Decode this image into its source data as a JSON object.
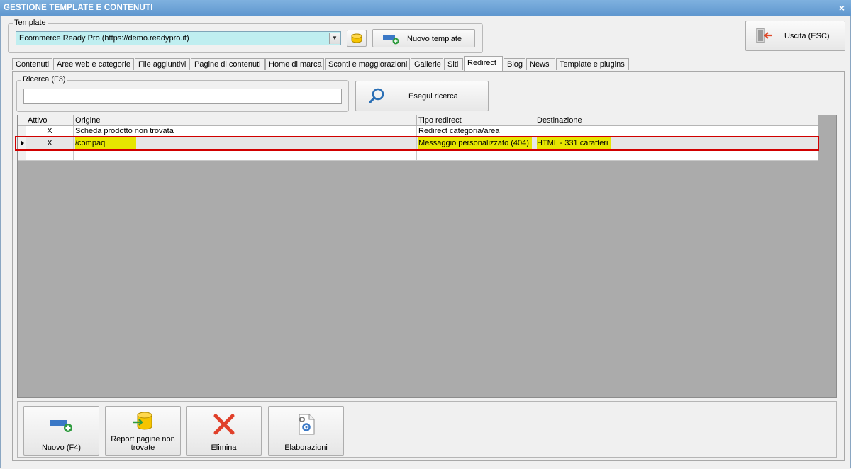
{
  "window": {
    "title": "GESTIONE TEMPLATE E CONTENUTI",
    "close_glyph": "×"
  },
  "template_group": {
    "legend": "Template",
    "selected": "Ecommerce Ready Pro (https://demo.readypro.it)",
    "new_template_label": "Nuovo template"
  },
  "exit_button": {
    "label": "Uscita (ESC)"
  },
  "tabs": [
    {
      "label": "Contenuti"
    },
    {
      "label": "Aree web e categorie"
    },
    {
      "label": "File aggiuntivi"
    },
    {
      "label": "Pagine di contenuti"
    },
    {
      "label": "Home di marca"
    },
    {
      "label": "Sconti e maggiorazioni"
    },
    {
      "label": "Gallerie"
    },
    {
      "label": "Siti"
    },
    {
      "label": "Redirect"
    },
    {
      "label": "Blog"
    },
    {
      "label": "News"
    },
    {
      "label": "Template e plugins"
    }
  ],
  "active_tab": "Redirect",
  "search": {
    "legend": "Ricerca (F3)",
    "value": "",
    "button_label": "Esegui ricerca"
  },
  "grid": {
    "columns": [
      "Attivo",
      "Origine",
      "Tipo redirect",
      "Destinazione"
    ],
    "rows": [
      {
        "attivo": "X",
        "origine": "Scheda prodotto non trovata",
        "tipo": "Redirect categoria/area",
        "destinazione": ""
      },
      {
        "attivo": "X",
        "origine": "/compaq",
        "tipo": "Messaggio personalizzato (404)",
        "destinazione": "HTML - 331 caratteri"
      }
    ]
  },
  "actions": [
    {
      "label": "Nuovo (F4)"
    },
    {
      "label": "Report pagine non trovate"
    },
    {
      "label": "Elimina"
    },
    {
      "label": "Elaborazioni"
    }
  ],
  "colors": {
    "highlight": "#e6e600",
    "selection_border": "#d10000",
    "combo_bg": "#bfeef0",
    "titlebar": "#6fa3d7"
  }
}
